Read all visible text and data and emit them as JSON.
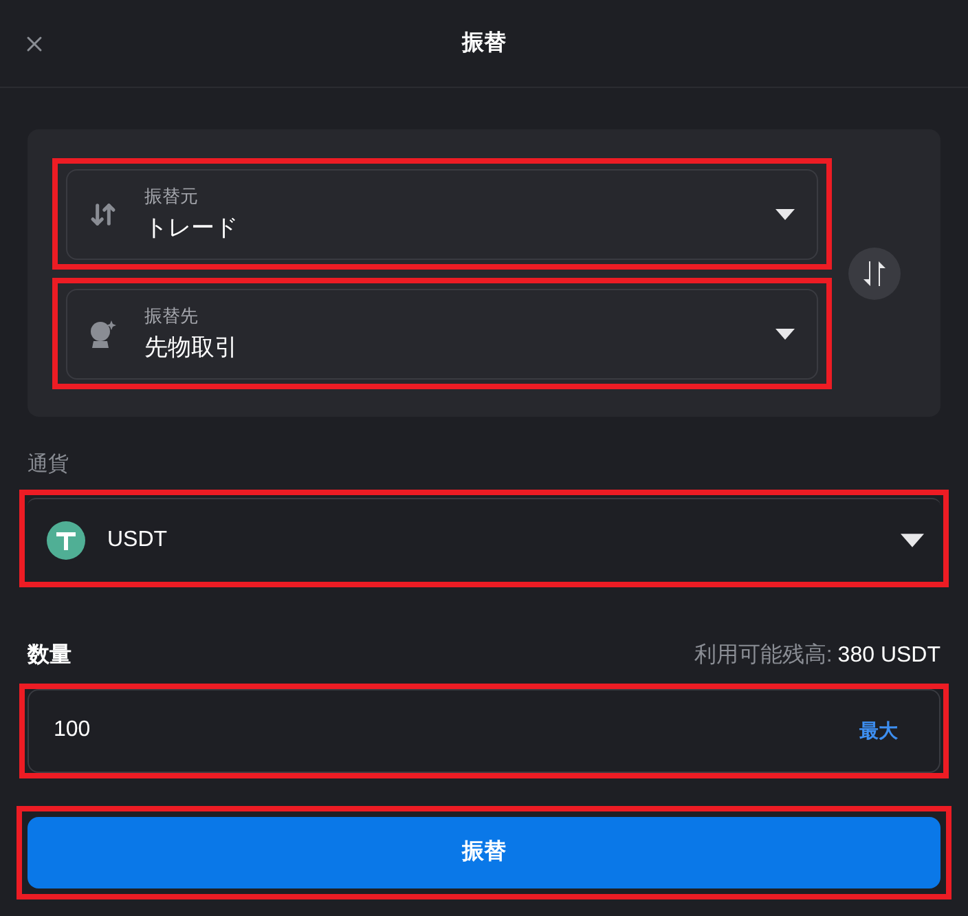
{
  "header": {
    "title": "振替"
  },
  "accounts": [
    {
      "kind": "from",
      "label": "振替元",
      "value": "トレード"
    },
    {
      "kind": "to",
      "label": "振替先",
      "value": "先物取引"
    }
  ],
  "currency": {
    "label": "通貨",
    "value": "USDT"
  },
  "amount": {
    "label": "数量",
    "available_label": "利用可能残高:",
    "available_value": "380 USDT",
    "value": "100",
    "max": "最大"
  },
  "submit": "振替"
}
